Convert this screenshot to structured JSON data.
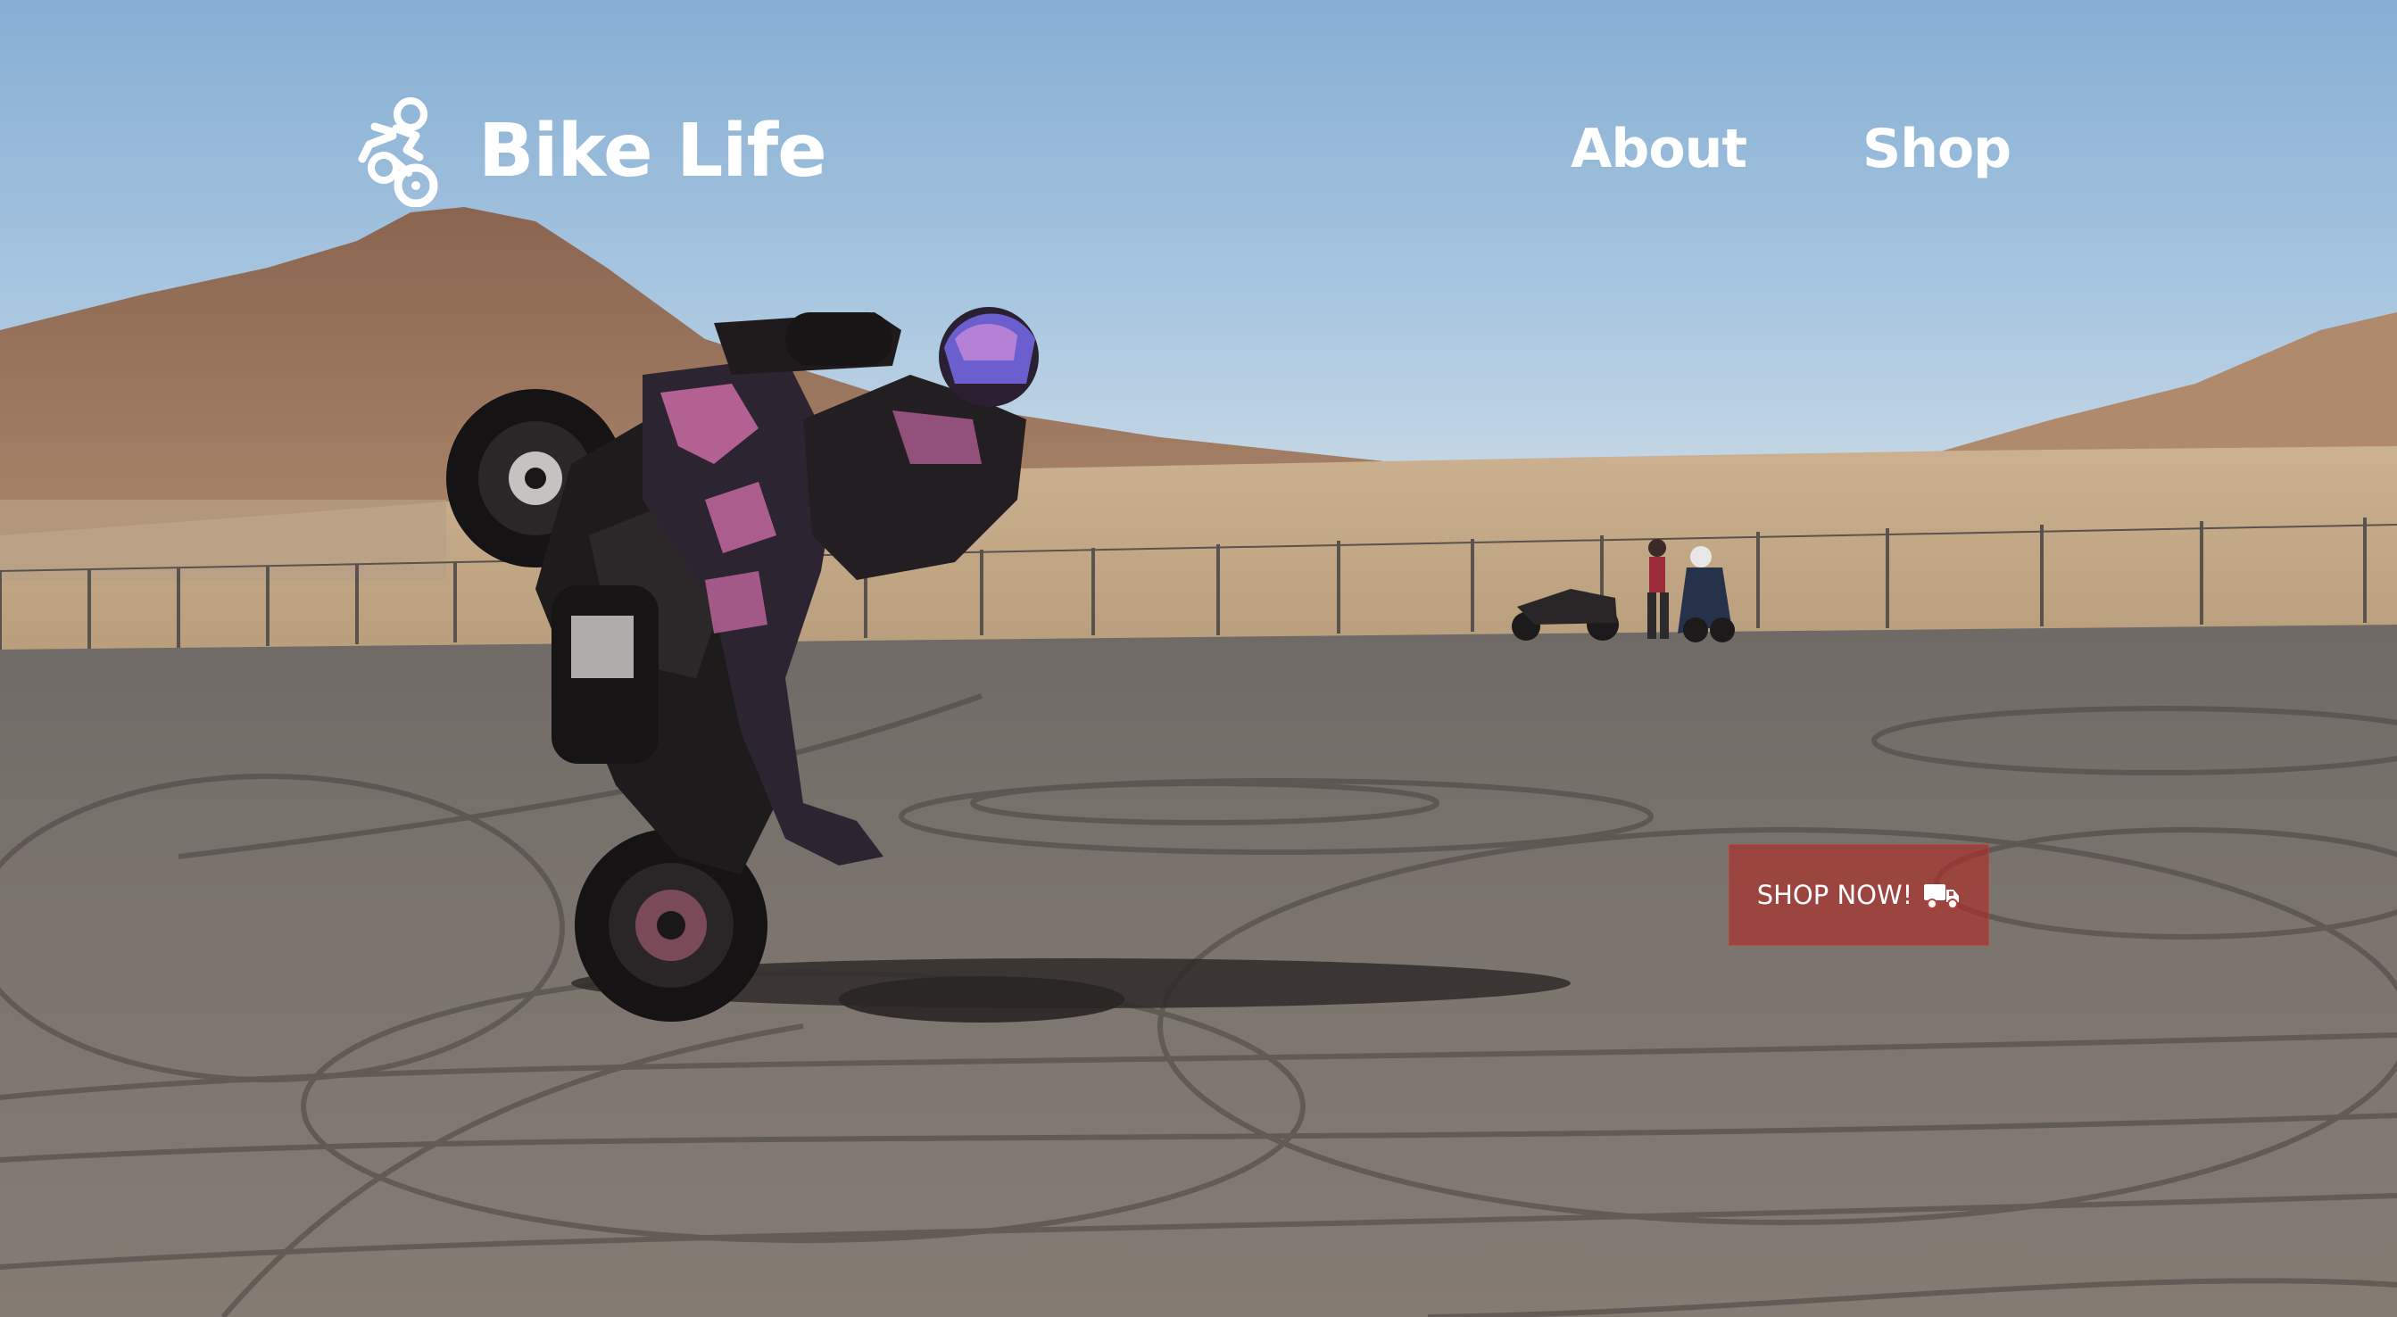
{
  "header": {
    "brand": {
      "name": "Bike Life",
      "icon": "motorcycle-rider-logo"
    },
    "nav": [
      {
        "label": "About"
      },
      {
        "label": "Shop"
      }
    ]
  },
  "hero": {
    "background": "stunt-rider-wheelie-desert-track-photo",
    "cta": {
      "label": "SHOP NOW!",
      "icon": "truck-icon",
      "color": "#b02824"
    }
  },
  "colors": {
    "nav_text": "#ffffff",
    "sky_top": "#86aed3",
    "asphalt": "#7d766f"
  }
}
